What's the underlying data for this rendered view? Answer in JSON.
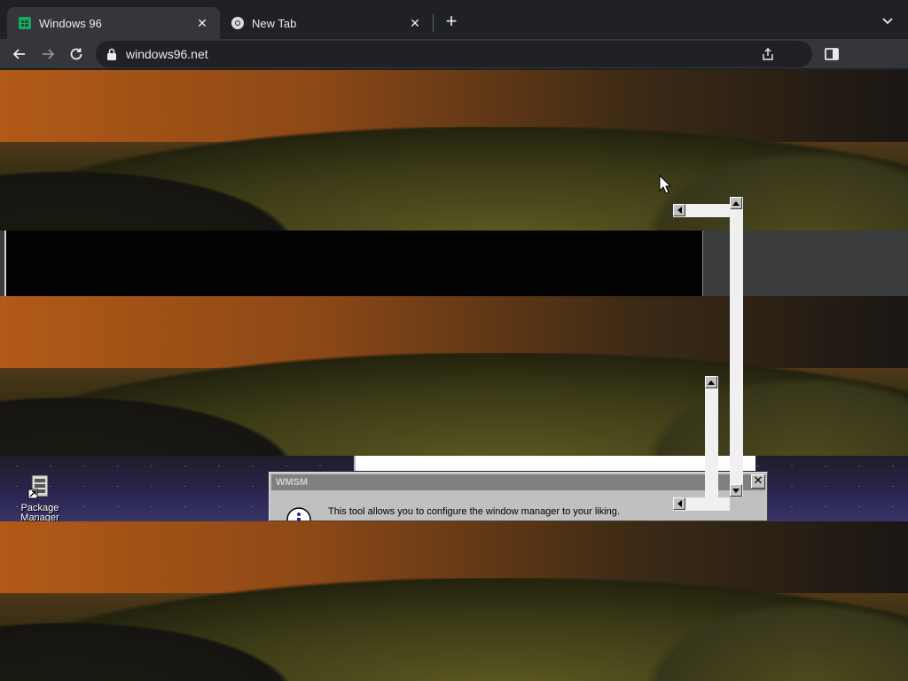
{
  "browser": {
    "tabs": [
      {
        "title": "Windows 96",
        "favicon": "windows96-icon",
        "active": true
      },
      {
        "title": "New Tab",
        "favicon": "chrome-icon",
        "active": false
      }
    ],
    "new_tab_label": "+",
    "close_label": "✕",
    "address": "windows96.net"
  },
  "desktop": {
    "icons": [
      {
        "label": "Package Manager",
        "icon": "package-manager-icon"
      }
    ]
  },
  "dialog": {
    "title": "WMSM",
    "close_label": "✕",
    "message": "This tool allows you to configure the window manager to your liking.",
    "icon": "info-icon"
  },
  "colors": {
    "chrome_bg": "#202124",
    "toolbar_bg": "#35363a",
    "win96_face": "#c0c0c0",
    "win96_title_inactive": "#808080"
  }
}
